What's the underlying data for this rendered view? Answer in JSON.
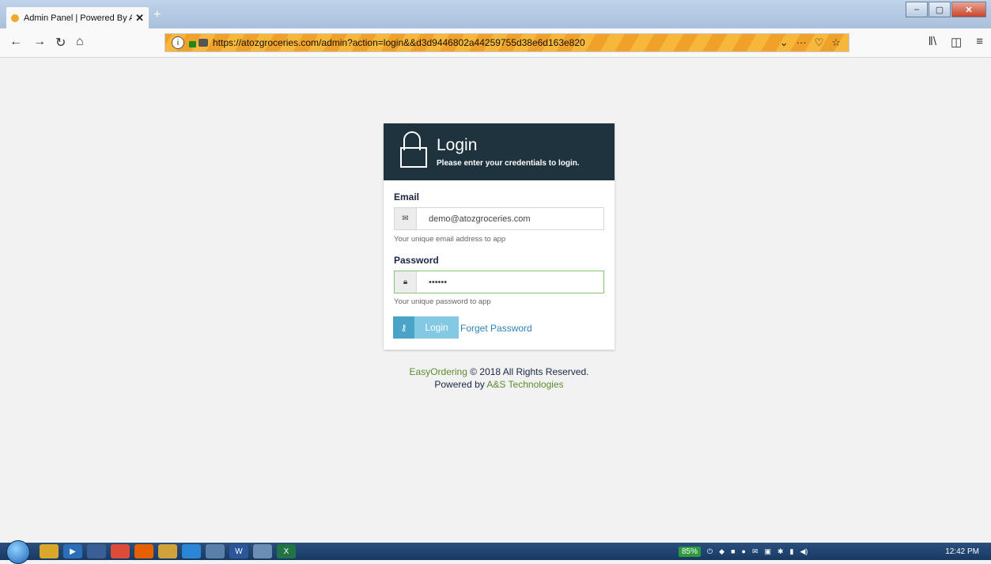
{
  "browser": {
    "tab_title": "Admin Panel | Powered By A&S",
    "tab_close": "✕",
    "new_tab": "+",
    "url": "https://atozgroceries.com/admin?action=login&&d3d9446802a44259755d38e6d163e820",
    "window_buttons": {
      "minimize": "–",
      "maximize": "▢",
      "close": "✕"
    },
    "url_actions": [
      "⌄",
      "···",
      "♡",
      "☆"
    ],
    "nav_glyphs": {
      "back": "←",
      "forward": "→",
      "reload": "↻",
      "home": "⌂",
      "info": "i"
    },
    "toolbar_glyphs": [
      "ǁ\\",
      "◫",
      "≡"
    ]
  },
  "login": {
    "header_title": "Login",
    "header_subtitle": "Please enter your credentials to login.",
    "email_label": "Email",
    "email_value": "demo@atozgroceries.com",
    "email_help": "Your unique email address to app",
    "password_label": "Password",
    "password_value": "••••••",
    "password_help": "Your unique password to app",
    "login_button": "Login",
    "forget_link": "Forget Password"
  },
  "footer": {
    "brand": "EasyOrdering",
    "copyright": " © 2018 All Rights Reserved.",
    "powered_prefix": "Powered by ",
    "company": "A&S Technologies"
  },
  "taskbar": {
    "battery": "85%",
    "clock": "12:42 PM",
    "apps": [
      {
        "name": "explorer-icon",
        "color": "#d9a82b",
        "glyph": ""
      },
      {
        "name": "media-player-icon",
        "color": "#2c6fb8",
        "glyph": "▶"
      },
      {
        "name": "app-icon",
        "color": "#3a5f95",
        "glyph": ""
      },
      {
        "name": "chrome-icon",
        "color": "#dd4b39",
        "glyph": ""
      },
      {
        "name": "firefox-icon",
        "color": "#e66000",
        "glyph": ""
      },
      {
        "name": "folder-icon",
        "color": "#d2a23a",
        "glyph": ""
      },
      {
        "name": "ie-icon",
        "color": "#2b86d6",
        "glyph": ""
      },
      {
        "name": "app2-icon",
        "color": "#5a7fa8",
        "glyph": ""
      },
      {
        "name": "word-icon",
        "color": "#2b579a",
        "glyph": "W"
      },
      {
        "name": "paint-icon",
        "color": "#6b8fb3",
        "glyph": ""
      },
      {
        "name": "excel-icon",
        "color": "#217346",
        "glyph": "X"
      }
    ]
  },
  "colors": {
    "header_bg": "#1e333e",
    "button_primary": "#83c9e3",
    "link": "#2a84b9",
    "brand_green": "#5c8c2e"
  }
}
